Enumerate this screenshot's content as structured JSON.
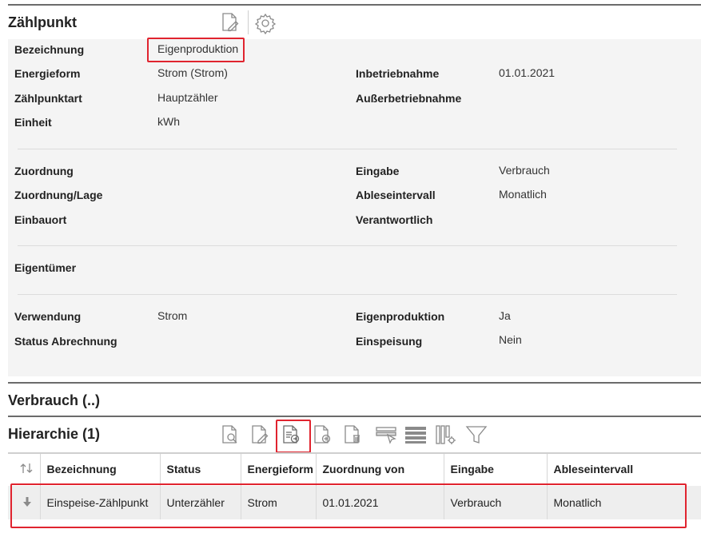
{
  "zaehlpunkt": {
    "title": "Zählpunkt",
    "icons": [
      "edit-document-icon",
      "gear-icon"
    ],
    "fields": {
      "bezeichnung": {
        "label": "Bezeichnung",
        "value": "Eigenproduktion"
      },
      "energieform": {
        "label": "Energieform",
        "value": "Strom (Strom)"
      },
      "inbetriebnahme": {
        "label": "Inbetriebnahme",
        "value": "01.01.2021"
      },
      "zaehlpunktart": {
        "label": "Zählpunktart",
        "value": "Hauptzähler"
      },
      "ausserbetriebnahme": {
        "label": "Außerbetriebnahme",
        "value": ""
      },
      "einheit": {
        "label": "Einheit",
        "value": "kWh"
      },
      "zuordnung": {
        "label": "Zuordnung",
        "value": ""
      },
      "eingabe": {
        "label": "Eingabe",
        "value": "Verbrauch"
      },
      "zuordnung_lage": {
        "label": "Zuordnung/Lage",
        "value": ""
      },
      "ableseintervall": {
        "label": "Ableseintervall",
        "value": "Monatlich"
      },
      "einbauort": {
        "label": "Einbauort",
        "value": ""
      },
      "verantwortlich": {
        "label": "Verantwortlich",
        "value": ""
      },
      "eigentuemer": {
        "label": "Eigentümer",
        "value": ""
      },
      "verwendung": {
        "label": "Verwendung",
        "value": "Strom"
      },
      "eigenproduktion": {
        "label": "Eigenproduktion",
        "value": "Ja"
      },
      "status_abrechnung": {
        "label": "Status Abrechnung",
        "value": ""
      },
      "einspeisung": {
        "label": "Einspeisung",
        "value": "Nein"
      }
    }
  },
  "verbrauch": {
    "title": "Verbrauch (..)"
  },
  "hierarchie": {
    "title": "Hierarchie (1)",
    "toolbar_icons": [
      "view-document-icon",
      "edit-document-icon",
      "navigate-document-icon",
      "add-document-icon",
      "delete-document-icon",
      "select-row-icon",
      "list-rows-icon",
      "column-settings-icon",
      "filter-icon"
    ],
    "columns": [
      "Bezeichnung",
      "Status",
      "Energieform",
      "Zuordnung von",
      "Eingabe",
      "Ableseintervall"
    ],
    "rows": [
      {
        "bezeichnung": "Einspeise-Zählpunkt",
        "status": "Unterzähler",
        "energieform": "Strom",
        "zuordnung_von": "01.01.2021",
        "eingabe": "Verbrauch",
        "ableseintervall": "Monatlich"
      }
    ]
  },
  "colors": {
    "highlight": "#e0242f",
    "panel": "#f4f4f4",
    "row": "#eeeeee",
    "section_rule": "#6b6b6b"
  }
}
